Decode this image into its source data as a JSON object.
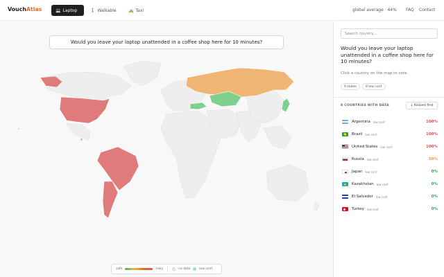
{
  "header": {
    "logo_part1": "Vouch",
    "logo_part2": "Atlas",
    "tabs": [
      {
        "label": "Laptop",
        "icon": "laptop-icon",
        "active": true
      },
      {
        "label": "Walkable",
        "icon": "walking-person-icon",
        "active": false
      },
      {
        "label": "Taxi",
        "icon": "taxi-icon",
        "active": false
      }
    ],
    "global_average": "global average · 44%",
    "faq": "FAQ",
    "contact": "Contact"
  },
  "map": {
    "question": "Would you leave your laptop unattended in a coffee shop here for 10 minutes?",
    "legend": {
      "safe": "safe",
      "risky": "risky",
      "no_data": "no data",
      "low_conf": "low conf."
    }
  },
  "side": {
    "search_placeholder": "Search country...",
    "question": "Would you leave your laptop unattended in a coffee shop here for 10 minutes?",
    "hint": "Click a country on the map to vote.",
    "chip_stable": "0 stable",
    "chip_low": "8 low conf.",
    "count_label": "8 COUNTRIES WITH DATA",
    "sort_label": "↓ Riskiest first",
    "countries": [
      {
        "name": "Argentina",
        "conf": "low conf.",
        "pct": "100%",
        "level": "red"
      },
      {
        "name": "Brazil",
        "conf": "low conf.",
        "pct": "100%",
        "level": "red"
      },
      {
        "name": "United States",
        "conf": "low conf.",
        "pct": "100%",
        "level": "red"
      },
      {
        "name": "Russia",
        "conf": "low conf.",
        "pct": "50%",
        "level": "orange"
      },
      {
        "name": "Japan",
        "conf": "low conf.",
        "pct": "0%",
        "level": "green"
      },
      {
        "name": "Kazakhstan",
        "conf": "low conf.",
        "pct": "0%",
        "level": "green"
      },
      {
        "name": "El Salvador",
        "conf": "low conf.",
        "pct": "0%",
        "level": "green"
      },
      {
        "name": "Turkey",
        "conf": "low conf.",
        "pct": "0%",
        "level": "green"
      }
    ]
  },
  "colors": {
    "risky": "#e07b7b",
    "mid": "#efb575",
    "safe": "#7fcf8f",
    "no_data": "#eeeeee",
    "accent": "#e0702a"
  }
}
